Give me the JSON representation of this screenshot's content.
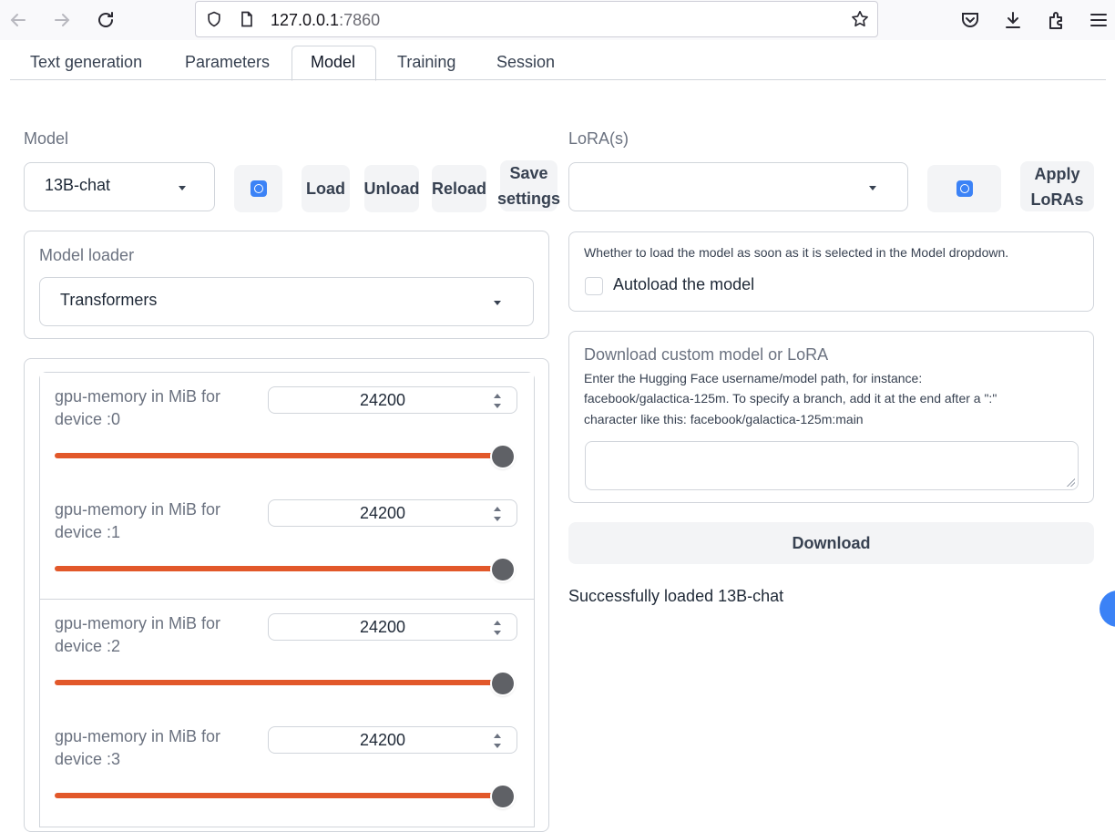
{
  "browser": {
    "url_host": "127.0.0.1",
    "url_port": ":7860"
  },
  "tabs": [
    {
      "label": "Text generation"
    },
    {
      "label": "Parameters"
    },
    {
      "label": "Model",
      "active": true
    },
    {
      "label": "Training"
    },
    {
      "label": "Session"
    }
  ],
  "model": {
    "label": "Model",
    "selected": "13B-chat",
    "buttons": {
      "load": "Load",
      "unload": "Unload",
      "reload": "Reload",
      "save_line1": "Save",
      "save_line2": "settings"
    }
  },
  "model_loader": {
    "label": "Model loader",
    "selected": "Transformers"
  },
  "gpu_memory": [
    {
      "label": "gpu-memory in MiB for device :0",
      "value": "24200",
      "fill_fraction": 1.0
    },
    {
      "label": "gpu-memory in MiB for device :1",
      "value": "24200",
      "fill_fraction": 1.0
    },
    {
      "label": "gpu-memory in MiB for device :2",
      "value": "24200",
      "fill_fraction": 1.0
    },
    {
      "label": "gpu-memory in MiB for device :3",
      "value": "24200",
      "fill_fraction": 1.0
    }
  ],
  "lora": {
    "label": "LoRA(s)",
    "selected": "",
    "apply_line1": "Apply",
    "apply_line2": "LoRAs"
  },
  "autoload": {
    "hint": "Whether to load the model as soon as it is selected in the Model dropdown.",
    "checkbox_label": "Autoload the model",
    "checked": false
  },
  "download": {
    "title": "Download custom model or LoRA",
    "line1": "Enter the Hugging Face username/model path, for instance:",
    "line2": "facebook/galactica-125m. To specify a branch, add it at the end after a \":\"",
    "line3": "character like this: facebook/galactica-125m:main",
    "input_value": "",
    "button": "Download"
  },
  "status": "Successfully loaded 13B-chat",
  "colors": {
    "slider": "#e2582a",
    "accent": "#3b82f6"
  }
}
